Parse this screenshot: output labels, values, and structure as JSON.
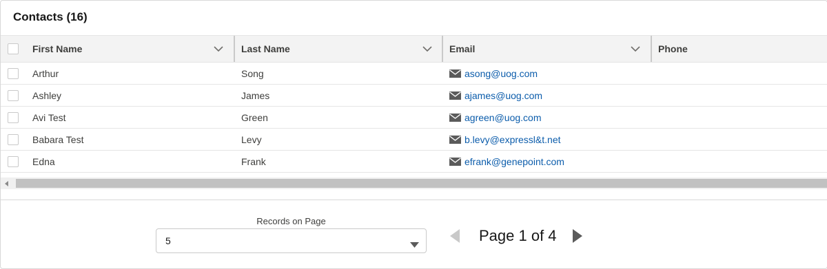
{
  "card": {
    "title": "Contacts (16)"
  },
  "table": {
    "columns": [
      {
        "label": "First Name"
      },
      {
        "label": "Last Name"
      },
      {
        "label": "Email"
      },
      {
        "label": "Phone"
      }
    ],
    "rows": [
      {
        "first_name": "Arthur",
        "last_name": "Song",
        "email": "asong@uog.com",
        "phone": ""
      },
      {
        "first_name": "Ashley",
        "last_name": "James",
        "email": "ajames@uog.com",
        "phone": ""
      },
      {
        "first_name": "Avi Test",
        "last_name": "Green",
        "email": "agreen@uog.com",
        "phone": ""
      },
      {
        "first_name": "Babara Test",
        "last_name": "Levy",
        "email": "b.levy@expressl&t.net",
        "phone": ""
      },
      {
        "first_name": "Edna",
        "last_name": "Frank",
        "email": "efrank@genepoint.com",
        "phone": ""
      }
    ]
  },
  "footer": {
    "records_label": "Records on Page",
    "records_value": "5",
    "page_text": "Page 1 of 4"
  },
  "icons": {
    "email": "envelope-icon",
    "sort": "chevron-down-icon",
    "prev": "triangle-left-icon",
    "next": "triangle-right-icon"
  },
  "colors": {
    "link": "#0b5cab",
    "header_bg": "#f3f3f3",
    "disabled": "#c9c9c9"
  }
}
